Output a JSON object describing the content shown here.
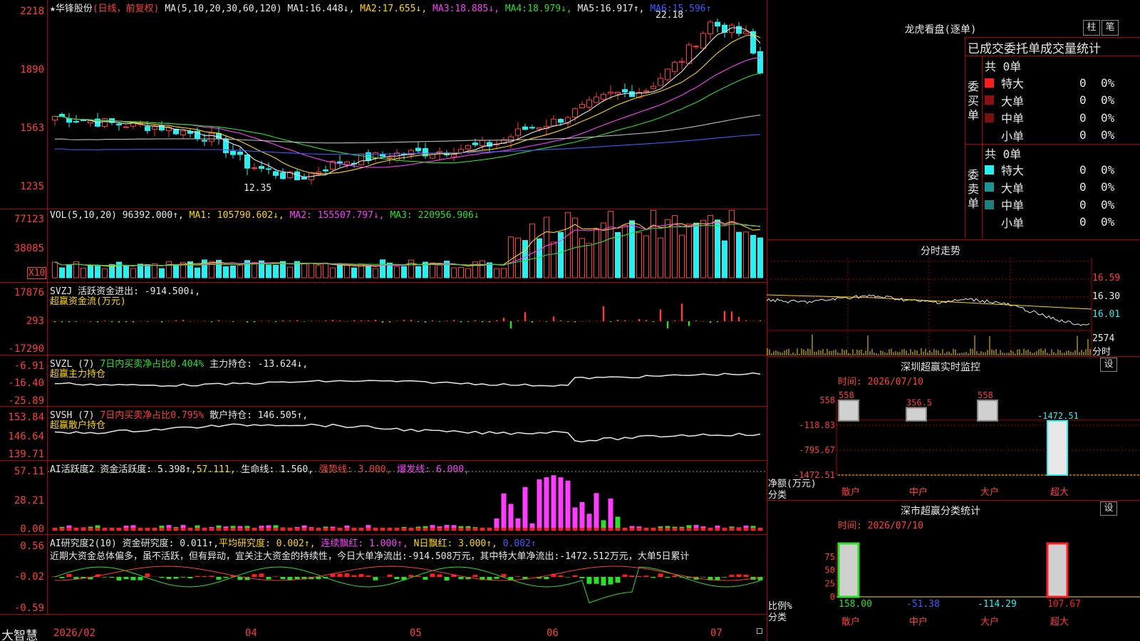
{
  "stock": {
    "name": "★华锋股份",
    "mode": "(日线，前复权)",
    "ma_label": "MA(5,10,20,30,60,120)",
    "ma": [
      {
        "label": "MA1:",
        "value": "16.448↓,",
        "color": "#e8e8e8"
      },
      {
        "label": "MA2:",
        "value": "17.655↓,",
        "color": "#ffd800"
      },
      {
        "label": "MA3:",
        "value": "18.885↓,",
        "color": "#ff3cff"
      },
      {
        "label": "MA4:",
        "value": "18.979↓,",
        "color": "#28e028"
      },
      {
        "label": "MA5:",
        "value": "16.917↑,",
        "color": "#e8e8e8"
      },
      {
        "label": "MA6:",
        "value": "15.596↑",
        "color": "#3c5cff"
      }
    ],
    "yticks": [
      "2218",
      "1890",
      "1563",
      "1235"
    ],
    "high_label": "22.18",
    "low_label": "12.35"
  },
  "vol": {
    "header": "VOL(5,10,20)",
    "value": "96392.000↑,",
    "ma1": "MA1: 105790.602↓,",
    "ma2": "MA2: 155507.797↓,",
    "ma3": "MA3: 220956.906↓",
    "yticks": [
      "77123",
      "38085"
    ],
    "unit": "X10"
  },
  "svzj": {
    "header": "SVZJ  活跃资金进出: -914.500↓,",
    "sub": "超赢资金流(万元)",
    "yticks": [
      "17876",
      "293",
      "-17290"
    ]
  },
  "svzl": {
    "header": "SVZL (7)",
    "ratio": "7日内买卖净占比0.404%",
    "hold": "主力持仓: -13.624↓,",
    "sub": "超赢主力持仓",
    "yticks": [
      "-6.91",
      "-16.40",
      "-25.89"
    ]
  },
  "svsh": {
    "header": "SVSH (7)",
    "ratio": "7日内买卖净占比0.795%",
    "hold": "散户持仓: 146.505↑,",
    "sub": "超赢散户持仓",
    "yticks": [
      "153.84",
      "146.64",
      "139.71"
    ]
  },
  "ai1": {
    "header": "AI活跃度2",
    "v1": "资金活跃度: 5.398↑,",
    "v2": "57.111,",
    "v3": "生命线: 1.560,",
    "v4": "强势线: 3.000,",
    "v5": "爆发线: 6.000,",
    "yticks": [
      "57.11",
      "28.21",
      "0.00"
    ]
  },
  "ai2": {
    "header": "AI研究度2(10)",
    "v1": "资金研究度: 0.011↑,",
    "v2": "平均研究度: 0.002↑,",
    "v3": "连续飘红: 1.000↑,",
    "v4": "N日飘红: 3.000↑,",
    "v5": "0.002↑",
    "comment": "近期大资金总体偏多，虽不活跃，但有异动，宜关注大资金的持续性，今日大单净流出:-914.508万元，其中特大单净流出:-1472.512万元，大单5日累计",
    "yticks": [
      "0.56",
      "-0.02",
      "-0.59"
    ]
  },
  "xaxis": {
    "brand": "大智慧",
    "labels": [
      "2026/02",
      "04",
      "05",
      "06",
      "07"
    ]
  },
  "right": {
    "lhb_title": "龙虎看盘(逐单)",
    "btn_column": "柱",
    "btn_stroke": "笔",
    "order_title": "已成交委托单成交量统计",
    "buy_label": "委买单",
    "sell_label": "委卖单",
    "buy_total": "共 0单",
    "sell_total": "共 0单",
    "buy_rows": [
      {
        "name": "特大",
        "count": "0",
        "pct": "0%",
        "color": "#ff1e1e"
      },
      {
        "name": "大单",
        "count": "0",
        "pct": "0%",
        "color": "#8c1010"
      },
      {
        "name": "中单",
        "count": "0",
        "pct": "0%",
        "color": "#781010"
      },
      {
        "name": "小单",
        "count": "0",
        "pct": "0%",
        "color": ""
      }
    ],
    "sell_rows": [
      {
        "name": "特大",
        "count": "0",
        "pct": "0%",
        "color": "#28f0f0"
      },
      {
        "name": "大单",
        "count": "0",
        "pct": "0%",
        "color": "#1a9494"
      },
      {
        "name": "中单",
        "count": "0",
        "pct": "0%",
        "color": "#1a8080"
      },
      {
        "name": "小单",
        "count": "0",
        "pct": "0%",
        "color": ""
      }
    ],
    "intraday_title": "分时走势",
    "intraday_yticks": [
      "16.59",
      "16.30",
      "16.01"
    ],
    "intraday_vol": "2574",
    "intraday_unit": "分时",
    "sz_monitor_title": "深圳超赢实时监控",
    "sz_class_title": "深市超赢分类统计",
    "btn_settings": "设",
    "time_label": "时间: 2026/07/10",
    "monitor_yticks": [
      "558",
      "-118.83",
      "-795.67",
      "-1472.51"
    ],
    "monitor_vals": [
      "558",
      "356.5",
      "558",
      "-1472.51"
    ],
    "monitor_ylabel1": "净额(万元)",
    "monitor_ylabel2": "分类",
    "class_yticks": [
      "75",
      "50",
      "25",
      "0"
    ],
    "class_vals": [
      "158.00",
      "-51.38",
      "-114.29",
      "107.67"
    ],
    "class_ylabel1": "比例%",
    "class_ylabel2": "分类",
    "categories": [
      "散户",
      "中户",
      "大户",
      "超大"
    ]
  },
  "chart_data": [
    {
      "type": "line",
      "title": "VOL(5,10,20)",
      "series": [
        {
          "name": "VOL",
          "values": [
            96392.0
          ]
        },
        {
          "name": "MA1",
          "values": [
            105790.602
          ]
        },
        {
          "name": "MA2",
          "values": [
            155507.797
          ]
        },
        {
          "name": "MA3",
          "values": [
            220956.906
          ]
        }
      ],
      "ylim": [
        0,
        77123
      ]
    },
    {
      "type": "bar",
      "title": "深圳超赢实时监控",
      "categories": [
        "散户",
        "中户",
        "大户",
        "超大"
      ],
      "values": [
        558,
        356.5,
        558,
        -1472.51
      ],
      "ylim": [
        -1472.51,
        558
      ]
    },
    {
      "type": "bar",
      "title": "深市超赢分类统计",
      "categories": [
        "散户",
        "中户",
        "大户",
        "超大"
      ],
      "values": [
        158.0,
        -51.38,
        -114.29,
        107.67
      ],
      "ylim": [
        0,
        100
      ]
    }
  ]
}
